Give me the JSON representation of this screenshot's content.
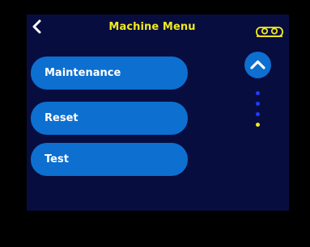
{
  "header": {
    "title": "Machine Menu",
    "back_icon": "chevron-left-icon",
    "status_icon": "cassette-icon"
  },
  "menu": {
    "items": [
      {
        "label": "Maintenance"
      },
      {
        "label": "Reset"
      },
      {
        "label": "Test"
      }
    ]
  },
  "pagination": {
    "scroll_icon": "chevron-up-icon",
    "page_count": 4,
    "current_page": 4
  },
  "colors": {
    "background": "#070d3f",
    "title": "#f2ea1c",
    "button": "#0d6fd0",
    "dot_inactive": "#1f3cff",
    "dot_active": "#f2ea1c"
  }
}
